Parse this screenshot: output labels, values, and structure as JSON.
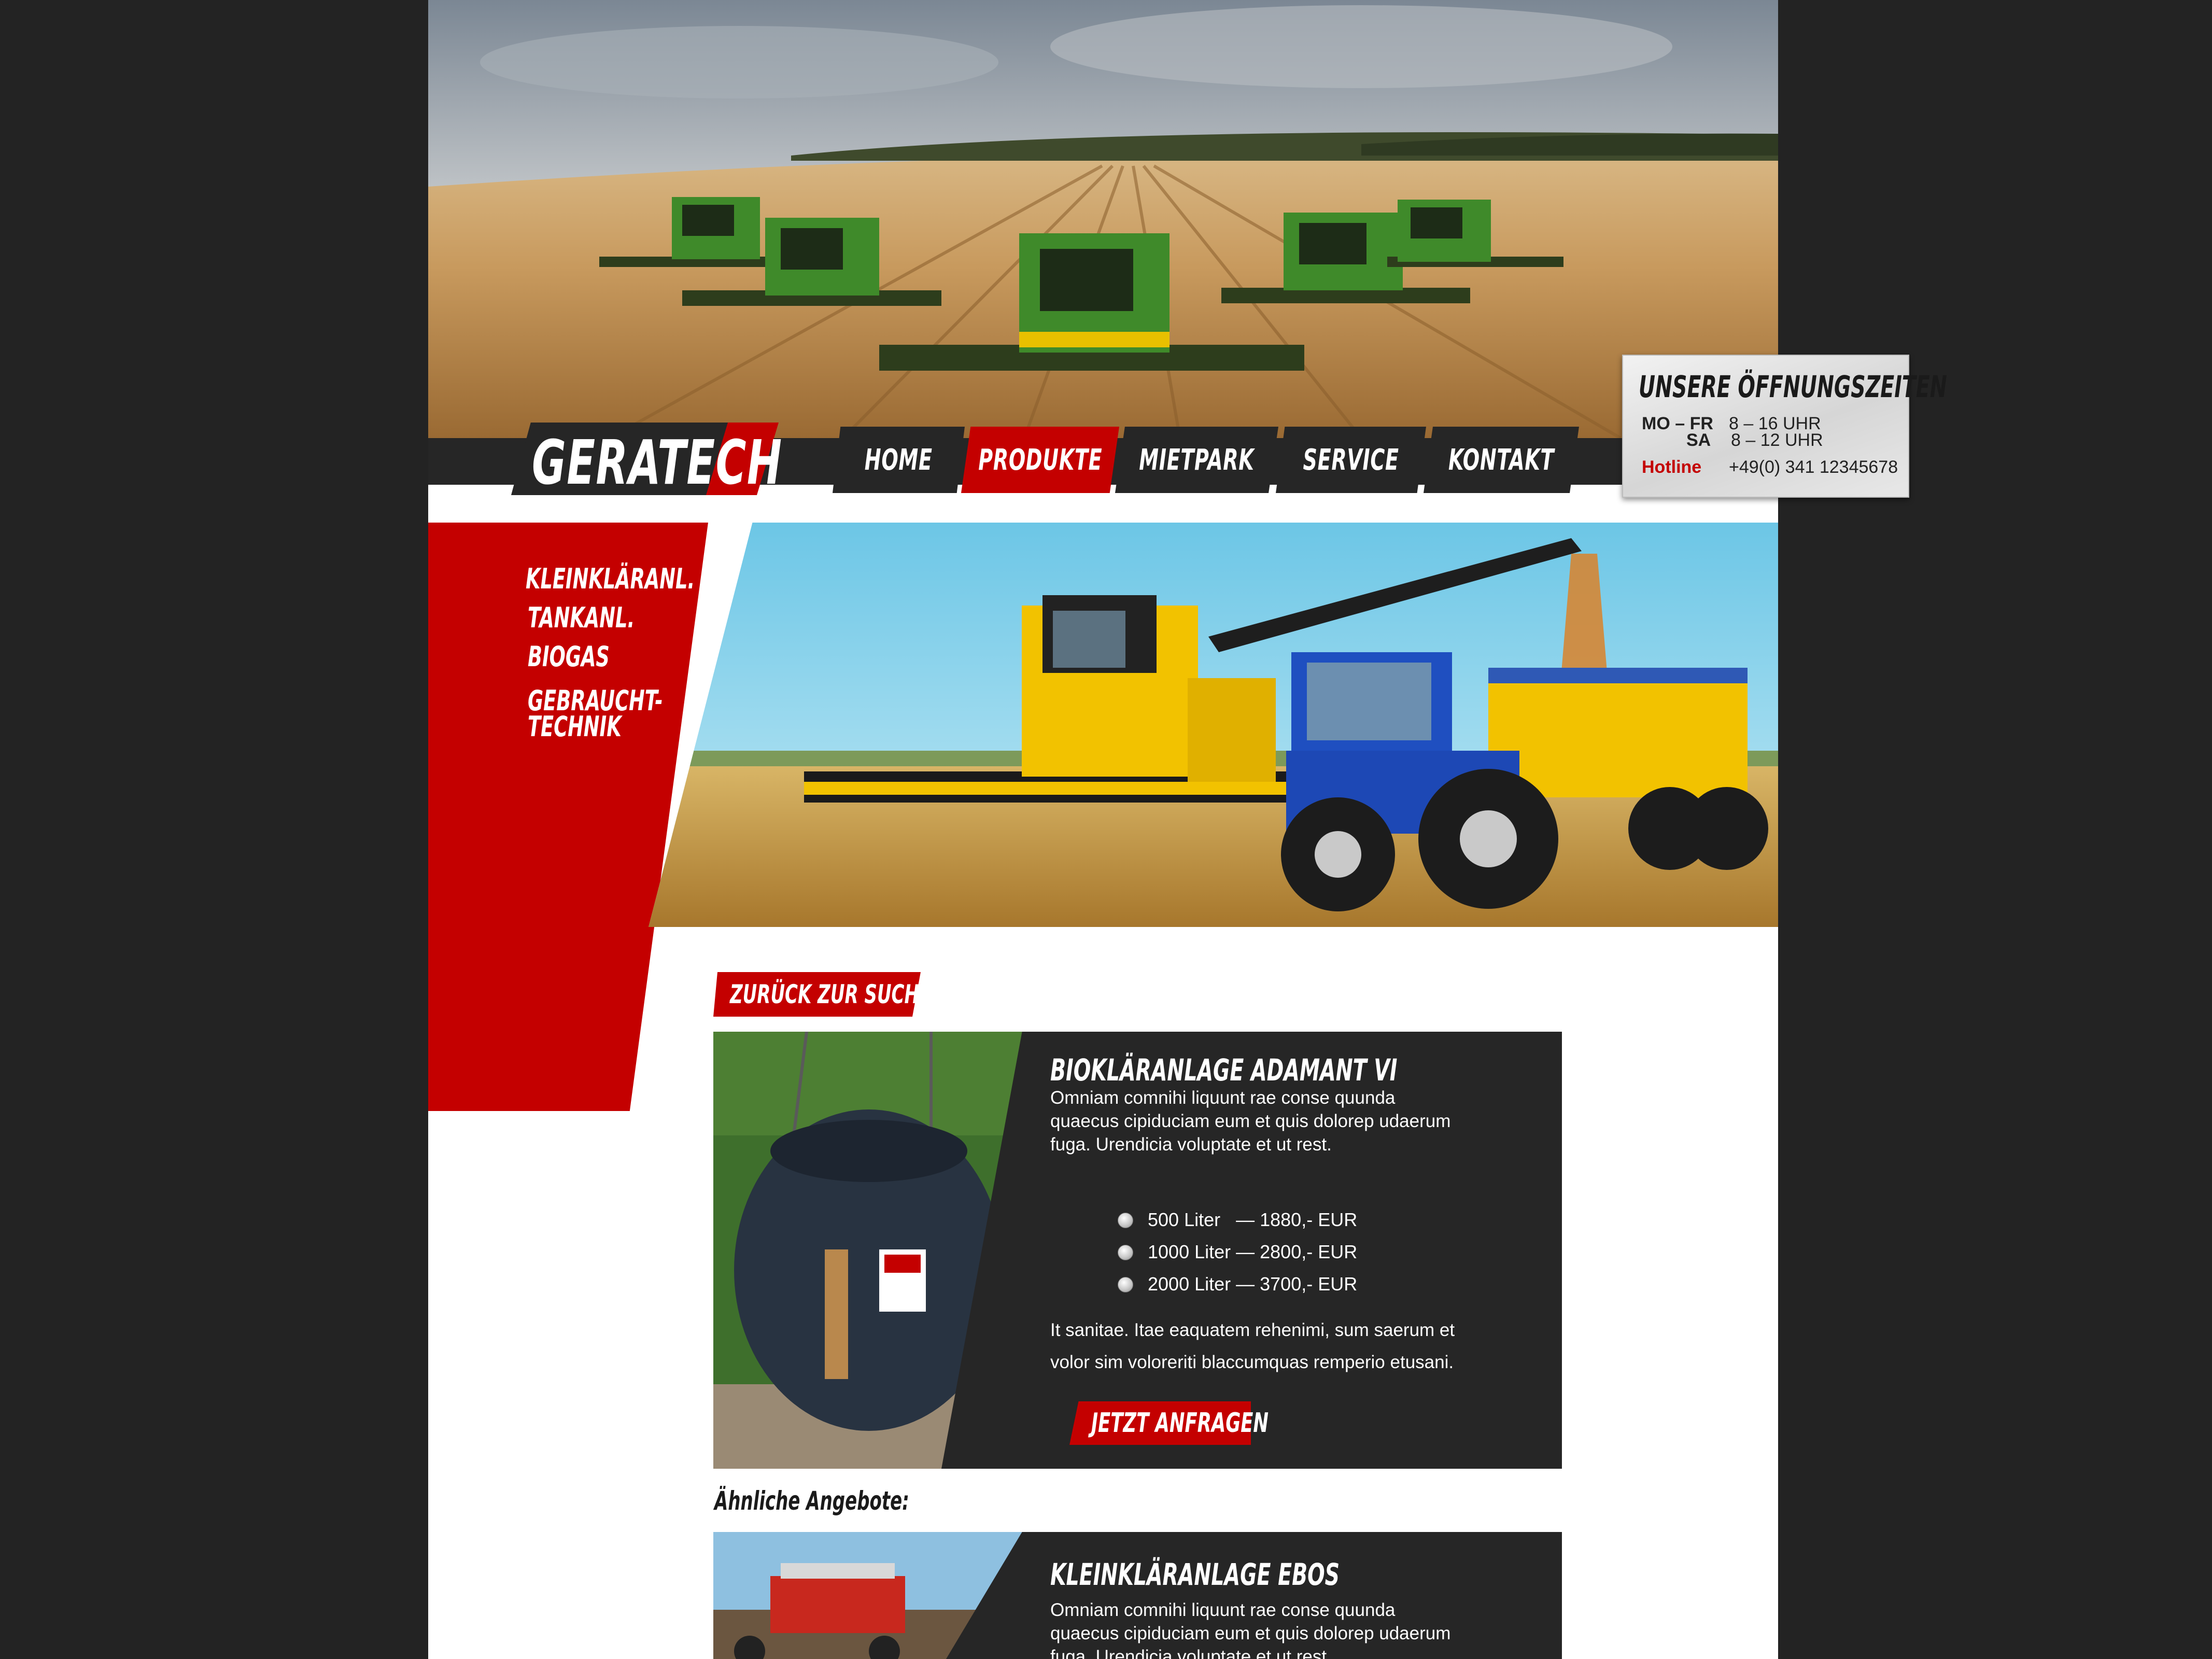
{
  "brand": {
    "logo": "GERATECH"
  },
  "nav": [
    {
      "label": "HOME",
      "active": false
    },
    {
      "label": "PRODUKTE",
      "active": true
    },
    {
      "label": "MIETPARK",
      "active": false
    },
    {
      "label": "SERVICE",
      "active": false
    },
    {
      "label": "KONTAKT",
      "active": false
    }
  ],
  "hours": {
    "title": "UNSERE ÖFFNUNGSZEITEN",
    "rows": [
      {
        "day": "MO – FR",
        "time": "8 – 16 UHR"
      },
      {
        "day": "SA",
        "time": "8 – 12 UHR"
      }
    ],
    "hotline_label": "Hotline",
    "hotline_number": "+49(0) 341 12345678"
  },
  "sidebar": {
    "items": [
      "KLEINKLÄRANL.",
      "TANKANL.",
      "BIOGAS",
      "GEBRAUCHT-",
      "TECHNIK"
    ]
  },
  "back_button": "ZURÜCK ZUR SUCHE",
  "product": {
    "title": "BIOKLÄRANLAGE ADAMANT VI",
    "desc_lines": [
      "Omniam comnihi liquunt rae conse quunda",
      "quaecus cipiduciam eum et quis dolorep udaerum",
      "fuga. Urendicia voluptate et ut rest."
    ],
    "options": [
      "500 Liter   — 1880,- EUR",
      "1000 Liter — 2800,- EUR",
      "2000 Liter — 3700,- EUR"
    ],
    "extra_lines": [
      "It sanitae. Itae eaquatem rehenimi, sum saerum et",
      "volor sim voloreriti blaccumquas remperio etusani."
    ],
    "cta": "JETZT ANFRAGEN"
  },
  "similar": {
    "heading": "Ähnliche Angebote:",
    "items": [
      {
        "title": "KLEINKLÄRANLAGE EBOS",
        "desc_lines": [
          "Omniam comnihi liquunt rae conse quunda",
          "quaecus cipiduciam eum et quis dolorep udaerum",
          "fuga. Urendicia voluptate et ut rest."
        ]
      }
    ]
  },
  "colors": {
    "accent_red": "#c40000",
    "dark": "#262626",
    "outer_bg": "#232323"
  }
}
